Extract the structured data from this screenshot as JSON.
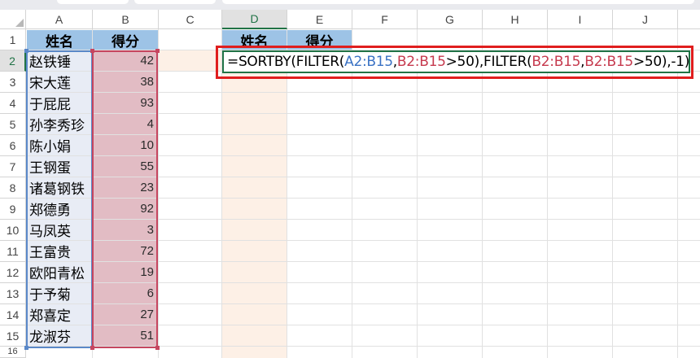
{
  "columns": [
    "A",
    "B",
    "C",
    "D",
    "E",
    "F",
    "G",
    "H",
    "I",
    "J"
  ],
  "rows": [
    "1",
    "2",
    "3",
    "4",
    "5",
    "6",
    "7",
    "8",
    "9",
    "10",
    "11",
    "12",
    "13",
    "14",
    "15",
    "16"
  ],
  "headers": {
    "name": "姓名",
    "score": "得分"
  },
  "output_headers": {
    "name": "姓名",
    "score": "得分"
  },
  "data": [
    {
      "name": "赵铁锤",
      "score": "42"
    },
    {
      "name": "宋大莲",
      "score": "38"
    },
    {
      "name": "于屁屁",
      "score": "93"
    },
    {
      "name": "孙李秀珍",
      "score": "4"
    },
    {
      "name": "陈小娟",
      "score": "10"
    },
    {
      "name": "王钢蛋",
      "score": "55"
    },
    {
      "name": "诸葛钢铁",
      "score": "23"
    },
    {
      "name": "郑德勇",
      "score": "92"
    },
    {
      "name": "马凤英",
      "score": "3"
    },
    {
      "name": "王富贵",
      "score": "72"
    },
    {
      "name": "欧阳青松",
      "score": "19"
    },
    {
      "name": "于予菊",
      "score": "6"
    },
    {
      "name": "郑喜定",
      "score": "27"
    },
    {
      "name": "龙淑芬",
      "score": "51"
    }
  ],
  "formula": {
    "p1": "=SORTBY(FILTER(",
    "p2": "A2:B15",
    "p3": ",",
    "p4": "B2:B15",
    "p5": ">50),FILTER(",
    "p6": "B2:B15",
    "p7": ",",
    "p8": "B2:B15",
    "p9": ">50),-1)"
  },
  "colors": {
    "header_fill": "#9dc3e6",
    "name_fill": "#e8ecf5",
    "score_fill": "#e2bcc4",
    "ref_blue": "#3a72c4",
    "ref_red": "#c63a4e",
    "highlight_box": "#e01e1e",
    "selection": "#217346"
  }
}
